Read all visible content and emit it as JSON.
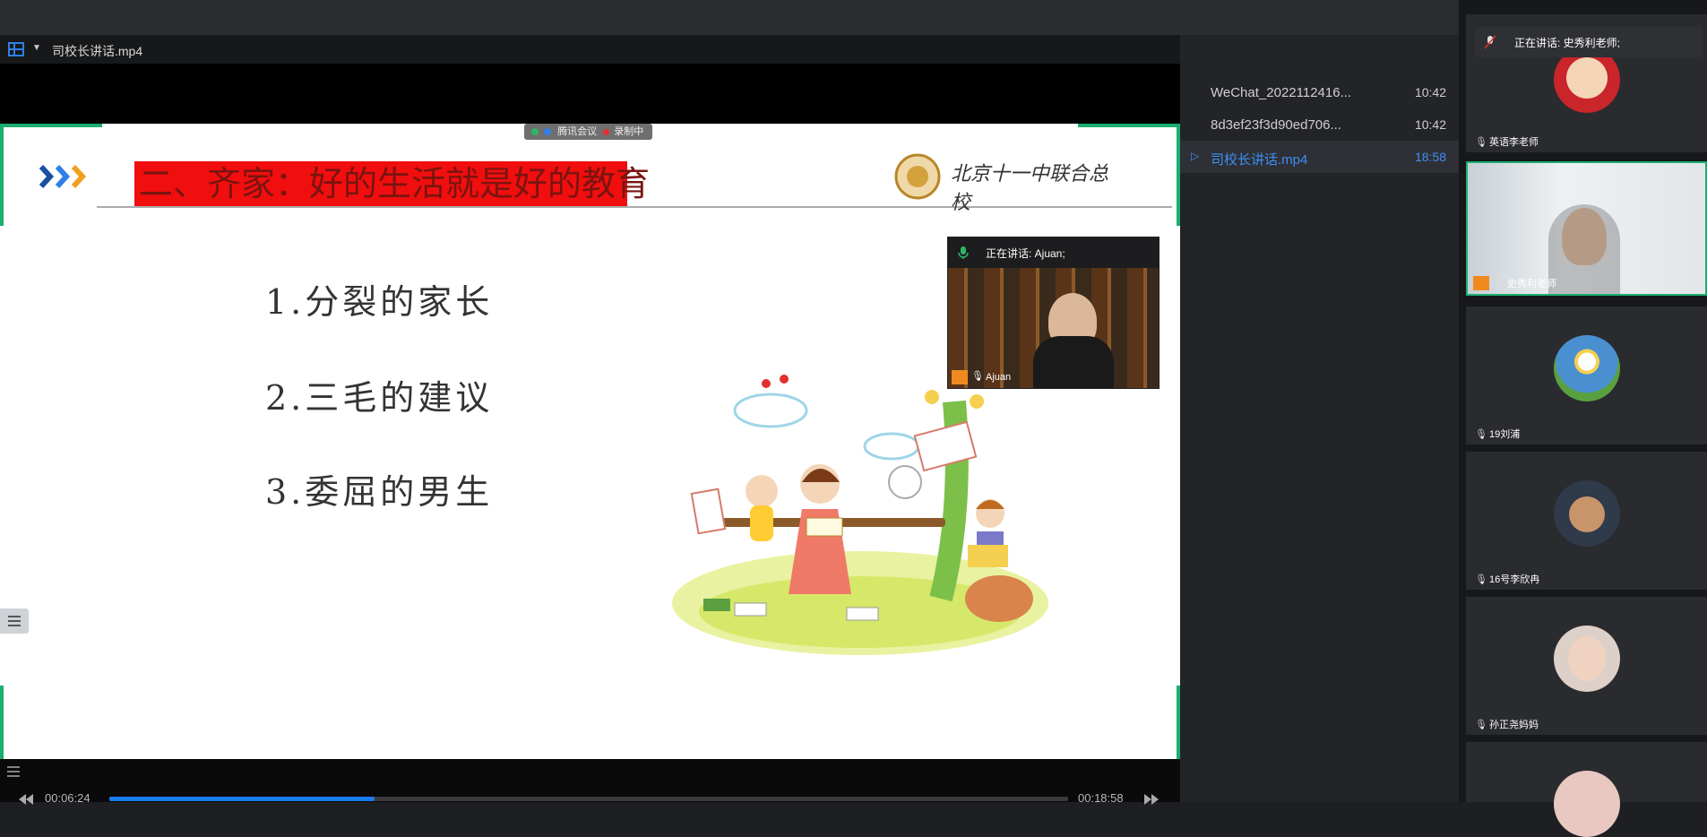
{
  "player": {
    "title": "司校长讲话.mp4",
    "slide": {
      "title": "二、齐家：好的生活就是好的教育",
      "items": [
        "1.分裂的家长",
        "2.三毛的建议",
        "3.委屈的男生"
      ],
      "school_logo_text": "北京十一中联合总校",
      "meeting_badge": "腾讯会议",
      "recording_badge": "录制中"
    },
    "overlay": {
      "speaking_label": "正在讲话: Ajuan;",
      "speaker_name": "Ajuan"
    },
    "controls": {
      "current_time": "00:06:24",
      "total_time": "00:18:58",
      "progress": 0.277
    }
  },
  "playlist": [
    {
      "name": "WeChat_2022112416...",
      "duration": "10:42",
      "active": false
    },
    {
      "name": "8d3ef23f3d90ed706...",
      "duration": "10:42",
      "active": false
    },
    {
      "name": "司校长讲话.mp4",
      "duration": "18:58",
      "active": true
    }
  ],
  "participants": {
    "speaking_label": "正在讲话: 史秀利老师;",
    "tiles": [
      {
        "name": "英语李老师",
        "avatar_color": "#c9252b"
      },
      {
        "name": "史秀利老师",
        "avatar_color": "#b8c0c6"
      },
      {
        "name": "19刘浦",
        "avatar_color": "#4a90d0"
      },
      {
        "name": "16号李欣冉",
        "avatar_color": "#2f3a4a"
      },
      {
        "name": "孙正尧妈妈",
        "avatar_color": "#ddd0c8"
      }
    ]
  },
  "colors": {
    "accent_blue": "#1a7cf0",
    "frame_green": "#1aaf6f",
    "title_red": "#f10e0e"
  }
}
